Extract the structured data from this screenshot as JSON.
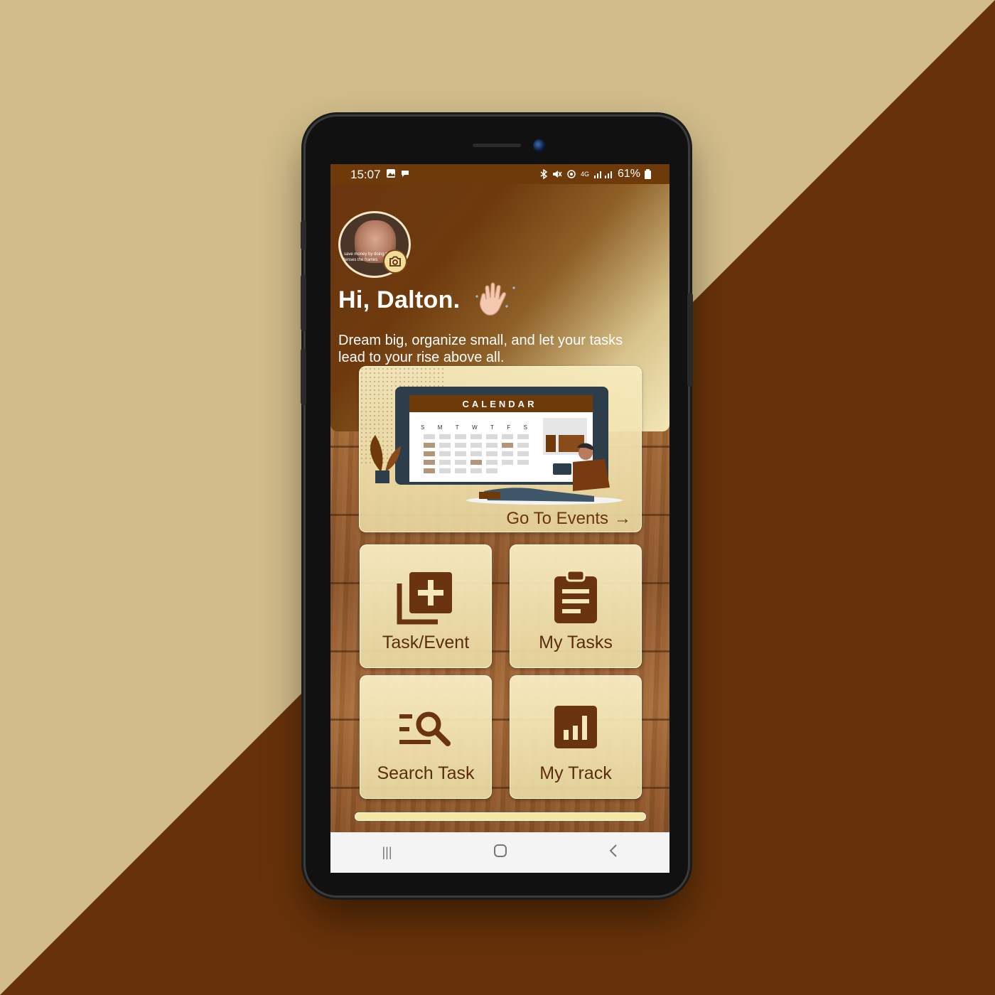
{
  "status_bar": {
    "time": "15:07",
    "network": "4G",
    "battery": "61%"
  },
  "header": {
    "avatar_caption": "save money by doing the lenses the frames",
    "greeting": "Hi, Dalton.",
    "tagline": "Dream big, organize small, and let your tasks lead to your rise above all."
  },
  "events_card": {
    "calendar_title": "CALENDAR",
    "weekdays": [
      "S",
      "M",
      "T",
      "W",
      "T",
      "F",
      "S"
    ],
    "link_label": "Go To Events",
    "link_arrow": "→"
  },
  "tiles": [
    {
      "label": "Task/Event",
      "icon": "add-task-icon"
    },
    {
      "label": "My Tasks",
      "icon": "clipboard-icon"
    },
    {
      "label": "Search Task",
      "icon": "search-list-icon"
    },
    {
      "label": "My Track",
      "icon": "bar-chart-icon"
    }
  ],
  "nav": {
    "recent": "|||",
    "home": "○",
    "back": "<"
  },
  "colors": {
    "brand_brown": "#6b3410",
    "background_tan": "#d1bc8a",
    "background_brown": "#673209",
    "card_cream": "#f5e9bc"
  }
}
